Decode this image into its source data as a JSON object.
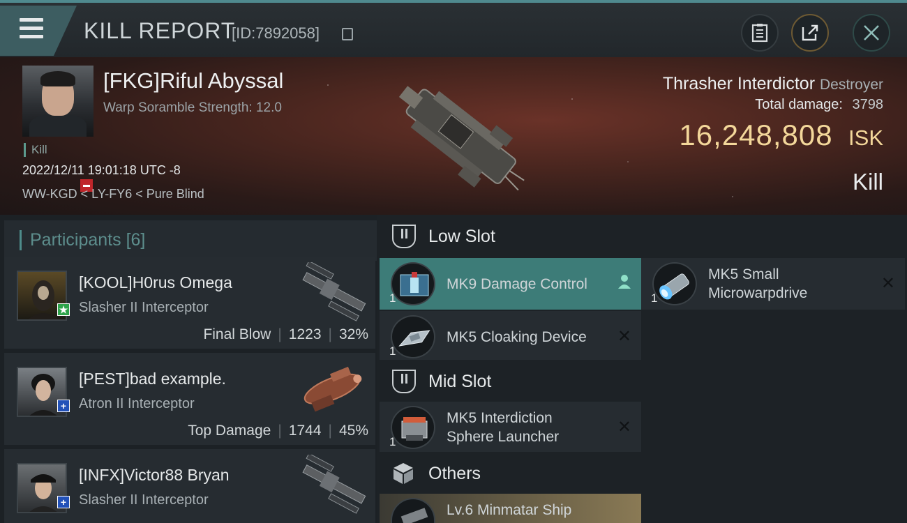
{
  "header": {
    "title": "KILL REPORT",
    "id_label": "[ID:7892058]"
  },
  "victim": {
    "name": "[FKG]Riful Abyssal",
    "subtitle": "Warp Soramble Strength: 12.0",
    "kill_tag": "Kill",
    "datetime": "2022/12/11 19:01:18 UTC -8",
    "location": "WW-KGD < LY-FY6 < Pure Blind",
    "ship_name": "Thrasher Interdictor",
    "ship_class": "Destroyer",
    "total_damage_label": "Total damage:",
    "total_damage": "3798",
    "isk_value": "16,248,808",
    "isk_unit": "ISK",
    "result": "Kill"
  },
  "participants": {
    "title": "Participants",
    "count": "[6]",
    "rows": [
      {
        "name": "[KOOL]H0rus Omega",
        "ship": "Slasher II Interceptor",
        "role": "Final Blow",
        "damage": "1223",
        "percent": "32%",
        "badge": "★",
        "badge_color": "#2ea34a"
      },
      {
        "name": "[PEST]bad example.",
        "ship": "Atron II Interceptor",
        "role": "Top Damage",
        "damage": "1744",
        "percent": "45%",
        "badge": "+",
        "badge_color": "#2251b8"
      },
      {
        "name": "[INFX]Victor88 Bryan",
        "ship": "Slasher II Interceptor",
        "role": "",
        "damage": "",
        "percent": "",
        "badge": "+",
        "badge_color": "#2251b8"
      }
    ]
  },
  "fittings": {
    "low_slot": "Low Slot",
    "mid_slot": "Mid Slot",
    "others": "Others",
    "low": [
      {
        "name": "MK9 Damage Control",
        "qty": "1"
      },
      {
        "name": "MK5 Small Microwarpdrive",
        "qty": "1"
      },
      {
        "name": "MK5 Cloaking Device",
        "qty": "1"
      }
    ],
    "mid": [
      {
        "name": "MK5 Interdiction Sphere Launcher",
        "qty": "1"
      }
    ],
    "other": [
      {
        "name": "Lv.6 Minmatar Ship"
      }
    ]
  },
  "colors": {
    "accent": "#4e8c8b",
    "isk": "#f3d79a",
    "selected": "#3d7c78",
    "destroyed_badge": "#c0262a"
  }
}
